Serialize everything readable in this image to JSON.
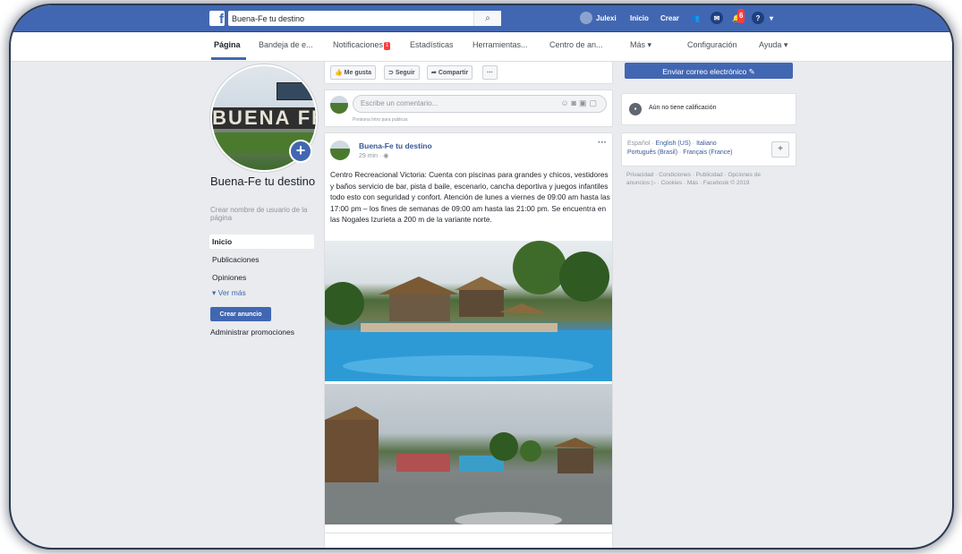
{
  "topbar": {
    "search_value": "Buena-Fe tu destino",
    "user_name": "Julexi",
    "home_label": "Inicio",
    "create_label": "Crear",
    "notification_count": "6"
  },
  "subnav": {
    "tabs": [
      "Página",
      "Bandeja de e...",
      "Notificaciones",
      "Estadísticas",
      "Herramientas...",
      "Centro de an...",
      "Más ▾",
      "Configuración",
      "Ayuda ▾"
    ],
    "notifications_badge": "1"
  },
  "profile": {
    "sign_text": "BUENA FE",
    "page_name": "Buena-Fe tu destino",
    "username_link": "Crear nombre de usuario de la página"
  },
  "left_nav": {
    "items": [
      "Inicio",
      "Publicaciones",
      "Opiniones"
    ],
    "see_more": "▾  Ver más",
    "create_ad": "Crear anuncio",
    "manage_promotions": "Administrar promociones"
  },
  "actions": {
    "like": "Me gusta",
    "follow": "Seguir",
    "share": "Compartir",
    "more": "···"
  },
  "composer": {
    "placeholder": "Escribe un comentario...",
    "hint": "Presiona Intro para publicar."
  },
  "post": {
    "author": "Buena-Fe tu destino",
    "time": "29 min · ◉",
    "text": "Centro Recreacional Victoria: Cuenta con piscinas para grandes y chicos, vestidores y baños servicio de bar, pista d baile, escenario, cancha deportiva y juegos infantiles todo esto con seguridad y confort. Atención de lunes a viernes de 09:00 am hasta las 17:00 pm – los fines de semanas de 09:00 am hasta las 21:00 pm. Se encuentra en las Nogales Izurieta a 200 m de la variante norte."
  },
  "right": {
    "email_button": "Enviar correo electrónico ✎",
    "rating_text": "Aún no tiene calificación",
    "lang_current": "Español · ",
    "lang_links": [
      "English (US)",
      "Italiano",
      "Português (Brasil)",
      "Français (France)"
    ],
    "footer": "Privacidad · Condiciones · Publicidad · Opciones de anuncios ▷ · Cookies · Más · Facebook © 2019"
  },
  "colors": {
    "brand": "#4267b2",
    "background": "#e9ebee",
    "link": "#385898"
  }
}
